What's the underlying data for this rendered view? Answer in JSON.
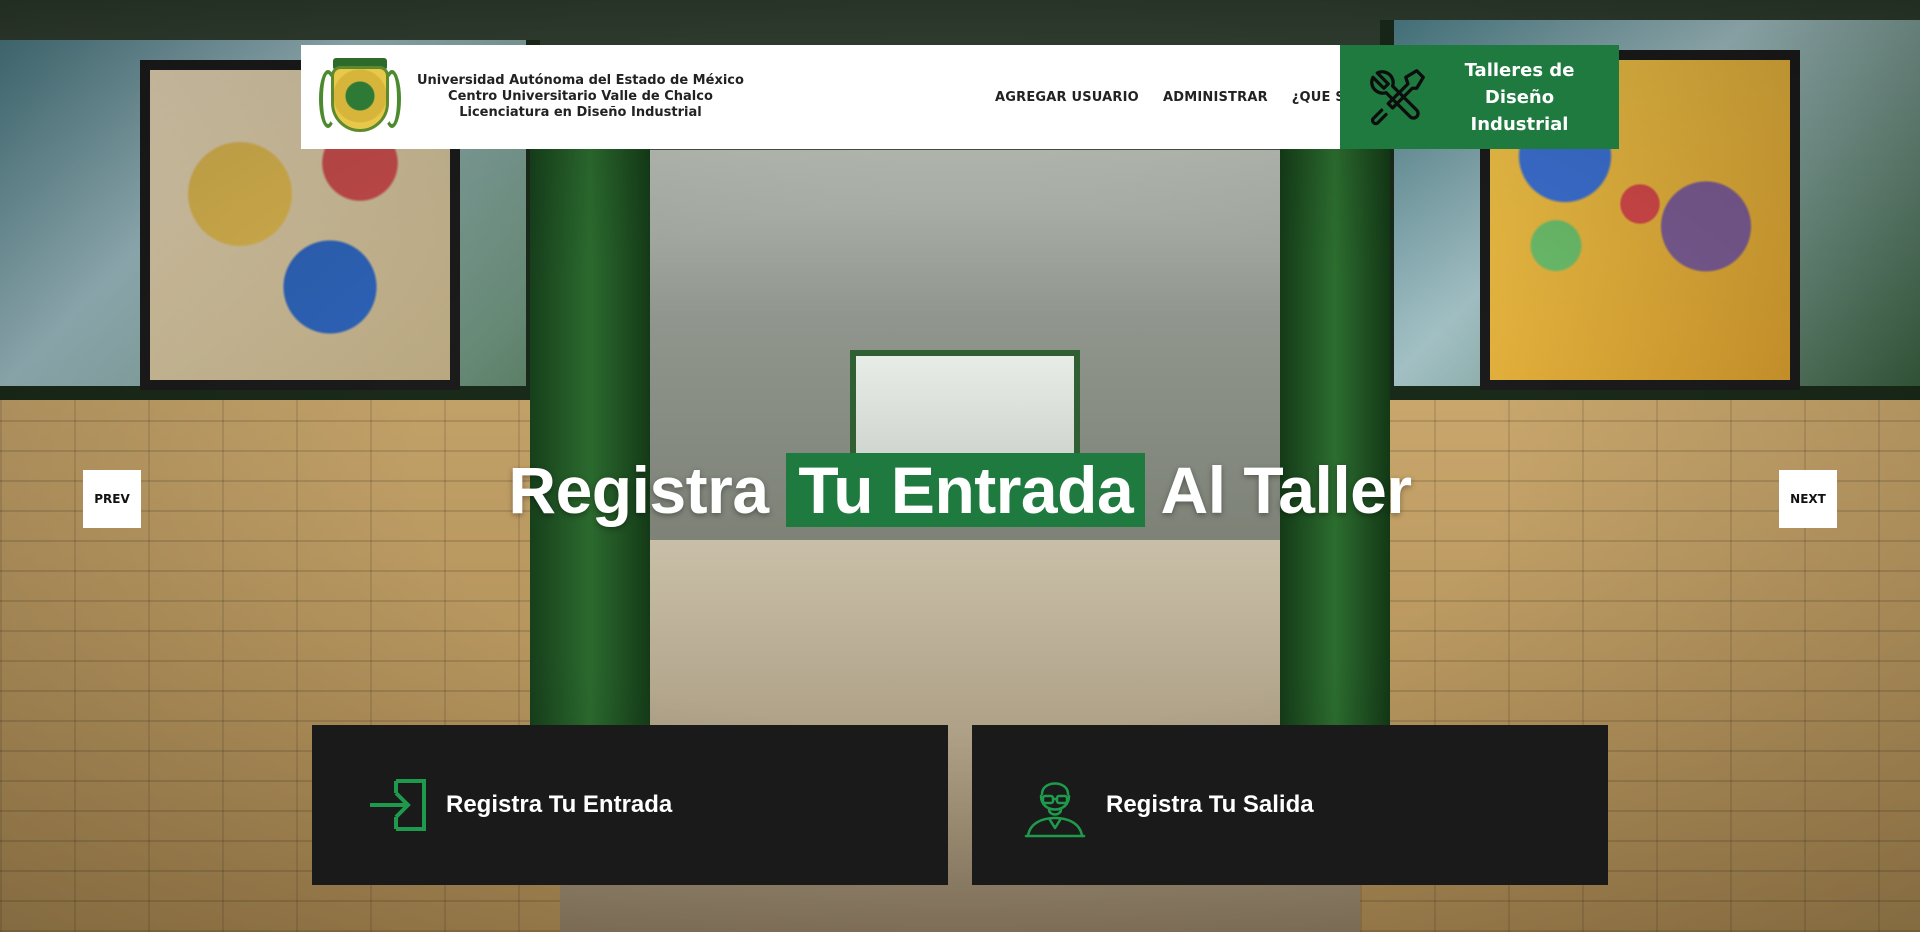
{
  "header": {
    "brand_lines": [
      "Universidad Autónoma del Estado de México",
      "Centro Universitario Valle de Chalco",
      "Licenciatura en Diseño Industrial"
    ],
    "nav": [
      "AGREGAR USUARIO",
      "ADMINISTRAR",
      "¿QUE SOMOS?"
    ],
    "badge_lines": [
      "Talleres de Diseño",
      "Industrial"
    ],
    "badge_icon": "tools-icon"
  },
  "hero": {
    "before": "Registra ",
    "highlight": "Tu Entrada",
    "after": " Al Taller"
  },
  "slider": {
    "prev_label": "PREV",
    "next_label": "NEXT"
  },
  "cards": [
    {
      "label": "Registra Tu Entrada",
      "icon": "login-icon"
    },
    {
      "label": "Registra Tu Salida",
      "icon": "user-avatar-icon"
    }
  ],
  "colors": {
    "accent": "#1f7a3f",
    "card_bg": "#1a1a1a",
    "header_bg": "#ffffff"
  }
}
